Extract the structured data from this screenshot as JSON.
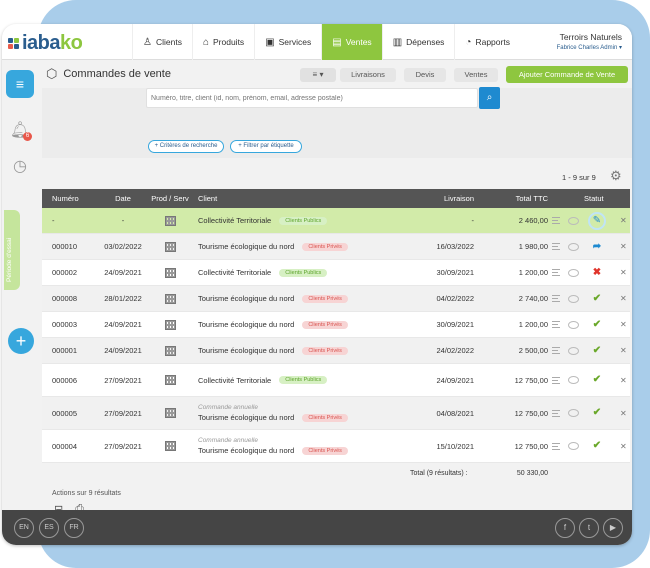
{
  "brand": {
    "logo_text_1": "iaba",
    "logo_text_2": "ko"
  },
  "nav": {
    "items": [
      {
        "label": "Clients",
        "icon": "person-icon"
      },
      {
        "label": "Produits",
        "icon": "tag-icon"
      },
      {
        "label": "Services",
        "icon": "briefcase-icon"
      },
      {
        "label": "Ventes",
        "icon": "document-icon",
        "active": true
      },
      {
        "label": "Dépenses",
        "icon": "receipt-icon"
      },
      {
        "label": "Rapports",
        "icon": "chart-icon"
      }
    ]
  },
  "user": {
    "org": "Terroirs Naturels",
    "name": "Fabrice Charles Admin"
  },
  "sidebar": {
    "bell_badge": "6",
    "vertical_label": "Période d'essai"
  },
  "page": {
    "title": "Commandes de vente",
    "view_button": "≡ ▾",
    "tabs": [
      "Livraisons",
      "Devis",
      "Ventes"
    ],
    "add_button": "Ajouter Commande de Vente"
  },
  "search": {
    "placeholder": "Numéro, titre, client (id, nom, prénom, email, adresse postale)",
    "criteria_button": "+ Critères de recherche",
    "tag_button": "+ Filtrer par étiquette"
  },
  "pager": {
    "text": "1 - 9 sur 9"
  },
  "table": {
    "headers": {
      "num": "Numéro",
      "date": "Date",
      "prod": "Prod / Serv",
      "client": "Client",
      "livraison": "Livraison",
      "total": "Total TTC",
      "status": "Statut"
    },
    "rows": [
      {
        "num": "-",
        "date": "-",
        "client": "Collectivité Territoriale",
        "tag": "Clients Publics",
        "tag_type": "pub",
        "note": "",
        "livraison": "-",
        "total": "2 460,00",
        "status": "edit",
        "style": "hl"
      },
      {
        "num": "000010",
        "date": "03/02/2022",
        "client": "Tourisme écologique du nord",
        "tag": "Clients Privés",
        "tag_type": "priv",
        "note": "",
        "livraison": "16/03/2022",
        "total": "1 980,00",
        "status": "arrow",
        "style": "alt"
      },
      {
        "num": "000002",
        "date": "24/09/2021",
        "client": "Collectivité Territoriale",
        "tag": "Clients Publics",
        "tag_type": "pub",
        "note": "",
        "livraison": "30/09/2021",
        "total": "1 200,00",
        "status": "cross",
        "style": ""
      },
      {
        "num": "000008",
        "date": "28/01/2022",
        "client": "Tourisme écologique du nord",
        "tag": "Clients Privés",
        "tag_type": "priv",
        "note": "",
        "livraison": "04/02/2022",
        "total": "2 740,00",
        "status": "check",
        "style": "alt"
      },
      {
        "num": "000003",
        "date": "24/09/2021",
        "client": "Tourisme écologique du nord",
        "tag": "Clients Privés",
        "tag_type": "priv",
        "note": "",
        "livraison": "30/09/2021",
        "total": "1 200,00",
        "status": "check",
        "style": ""
      },
      {
        "num": "000001",
        "date": "24/09/2021",
        "client": "Tourisme écologique du nord",
        "tag": "Clients Privés",
        "tag_type": "priv",
        "note": "",
        "livraison": "24/02/2022",
        "total": "2 500,00",
        "status": "check",
        "style": "alt"
      },
      {
        "num": "000006",
        "date": "27/09/2021",
        "client": "Collectivité Territoriale",
        "tag": "Clients Publics",
        "tag_type": "pub",
        "note": "",
        "livraison": "24/09/2021",
        "total": "12 750,00",
        "status": "check",
        "style": "tall"
      },
      {
        "num": "000005",
        "date": "27/09/2021",
        "client": "Tourisme écologique du nord",
        "tag": "Clients Privés",
        "tag_type": "priv",
        "note": "Commande annuelle",
        "livraison": "04/08/2021",
        "total": "12 750,00",
        "status": "check",
        "style": "alt tall"
      },
      {
        "num": "000004",
        "date": "27/09/2021",
        "client": "Tourisme écologique du nord",
        "tag": "Clients Privés",
        "tag_type": "priv",
        "note": "Commande annuelle",
        "livraison": "15/10/2021",
        "total": "12 750,00",
        "status": "check",
        "style": "tall"
      }
    ],
    "total_label": "Total (9 résultats) :",
    "total_value": "50 330,00"
  },
  "actions": {
    "label": "Actions sur 9 résultats"
  },
  "footer": {
    "langs": [
      "EN",
      "ES",
      "FR"
    ],
    "social": [
      "f",
      "t",
      "▶"
    ]
  },
  "colors": {
    "accent_green": "#8ec63f",
    "accent_blue": "#37a7dd",
    "brand_blue": "#2a5d8e",
    "footer": "#454545"
  }
}
